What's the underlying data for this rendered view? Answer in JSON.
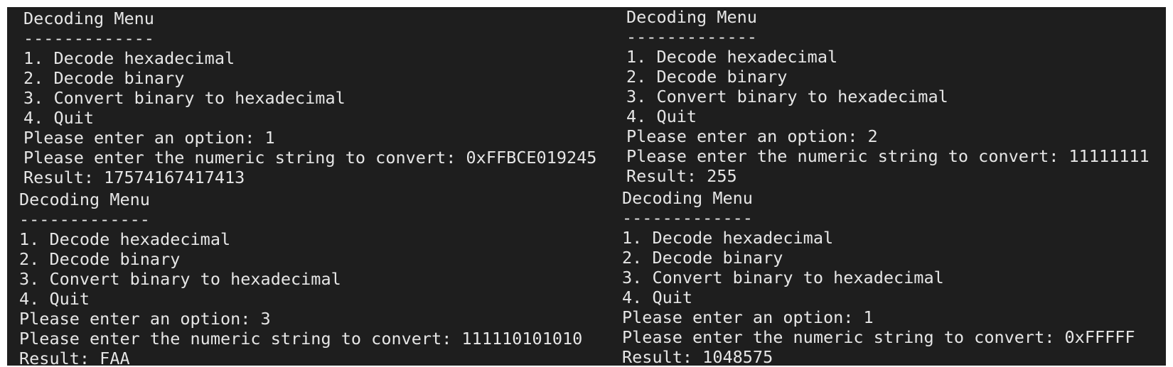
{
  "terminals": [
    {
      "menu_title": "Decoding Menu",
      "separator": "-------------",
      "options": [
        "1. Decode hexadecimal",
        "2. Decode binary",
        "3. Convert binary to hexadecimal",
        "4. Quit"
      ],
      "option_prompt": "Please enter an option: 1",
      "string_prompt": "Please enter the numeric string to convert: 0xFFBCE019245",
      "result": "Result: 17574167417413"
    },
    {
      "menu_title": "Decoding Menu",
      "separator": "-------------",
      "options": [
        "1. Decode hexadecimal",
        "2. Decode binary",
        "3. Convert binary to hexadecimal",
        "4. Quit"
      ],
      "option_prompt": "Please enter an option: 2",
      "string_prompt": "Please enter the numeric string to convert: 11111111",
      "result": "Result: 255"
    },
    {
      "menu_title": "Decoding Menu",
      "separator": "-------------",
      "options": [
        "1. Decode hexadecimal",
        "2. Decode binary",
        "3. Convert binary to hexadecimal",
        "4. Quit"
      ],
      "option_prompt": "Please enter an option: 3",
      "string_prompt": "Please enter the numeric string to convert: 111110101010",
      "result": "Result: FAA"
    },
    {
      "menu_title": "Decoding Menu",
      "separator": "-------------",
      "options": [
        "1. Decode hexadecimal",
        "2. Decode binary",
        "3. Convert binary to hexadecimal",
        "4. Quit"
      ],
      "option_prompt": "Please enter an option: 1",
      "string_prompt": "Please enter the numeric string to convert: 0xFFFFF",
      "result": "Result: 1048575"
    }
  ]
}
